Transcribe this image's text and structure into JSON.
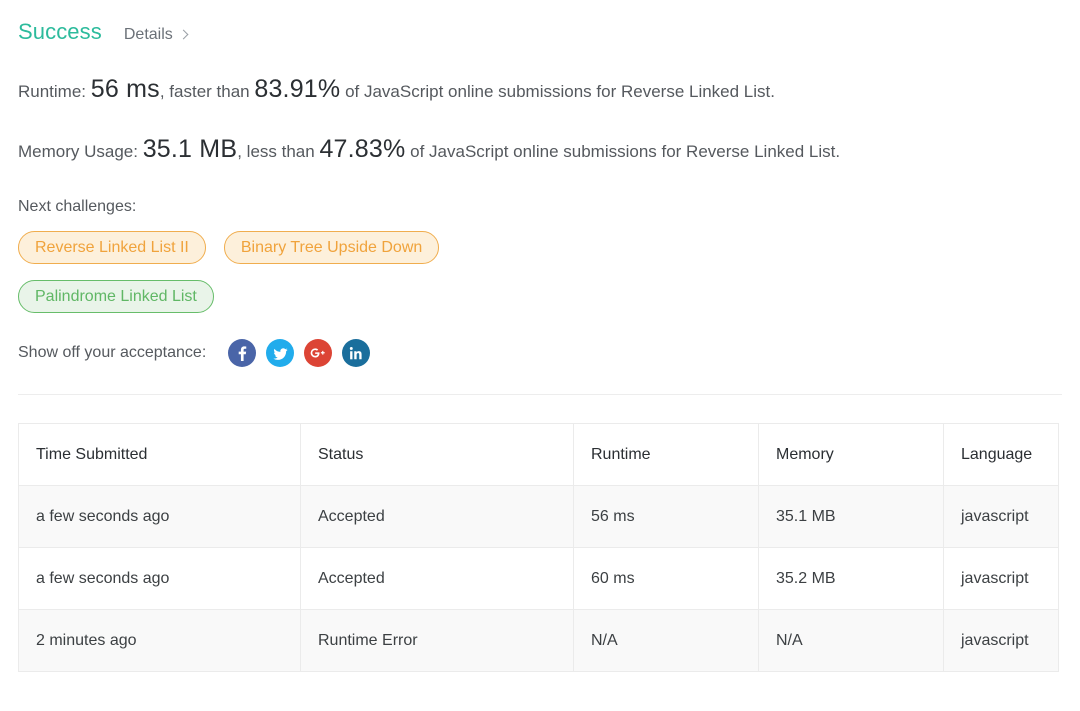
{
  "header": {
    "status_title": "Success",
    "details_label": "Details",
    "chevron_icon": "chevron-right-icon"
  },
  "stats": {
    "runtime": {
      "label_prefix": "Runtime: ",
      "value": "56 ms",
      "mid_text": ", faster than ",
      "percent": "83.91%",
      "suffix": " of JavaScript online submissions for Reverse Linked List."
    },
    "memory": {
      "label_prefix": "Memory Usage: ",
      "value": "35.1 MB",
      "mid_text": ", less than ",
      "percent": "47.83%",
      "suffix": " of JavaScript online submissions for Reverse Linked List."
    }
  },
  "next_challenges": {
    "label": "Next challenges:",
    "tags": [
      {
        "label": "Reverse Linked List II",
        "style": "orange"
      },
      {
        "label": "Binary Tree Upside Down",
        "style": "orange"
      },
      {
        "label": "Palindrome Linked List",
        "style": "green"
      }
    ]
  },
  "share": {
    "label": "Show off your acceptance:",
    "icons": [
      {
        "name": "facebook-icon",
        "color": "#4a65a8"
      },
      {
        "name": "twitter-icon",
        "color": "#21acec"
      },
      {
        "name": "google-plus-icon",
        "color": "#dc4435"
      },
      {
        "name": "linkedin-icon",
        "color": "#1a6e9c"
      }
    ]
  },
  "submissions_table": {
    "columns": [
      "Time Submitted",
      "Status",
      "Runtime",
      "Memory",
      "Language"
    ],
    "rows": [
      {
        "time": "a few seconds ago",
        "status": "Accepted",
        "status_state": "accepted",
        "runtime": "56 ms",
        "memory": "35.1 MB",
        "language": "javascript"
      },
      {
        "time": "a few seconds ago",
        "status": "Accepted",
        "status_state": "accepted",
        "runtime": "60 ms",
        "memory": "35.2 MB",
        "language": "javascript"
      },
      {
        "time": "2 minutes ago",
        "status": "Runtime Error",
        "status_state": "error",
        "runtime": "N/A",
        "memory": "N/A",
        "language": "javascript"
      }
    ]
  },
  "colors": {
    "success_green": "#2cbb9c",
    "error_red": "#ef4236",
    "tag_orange": "#f0ad4e",
    "tag_green": "#67bd6a"
  }
}
